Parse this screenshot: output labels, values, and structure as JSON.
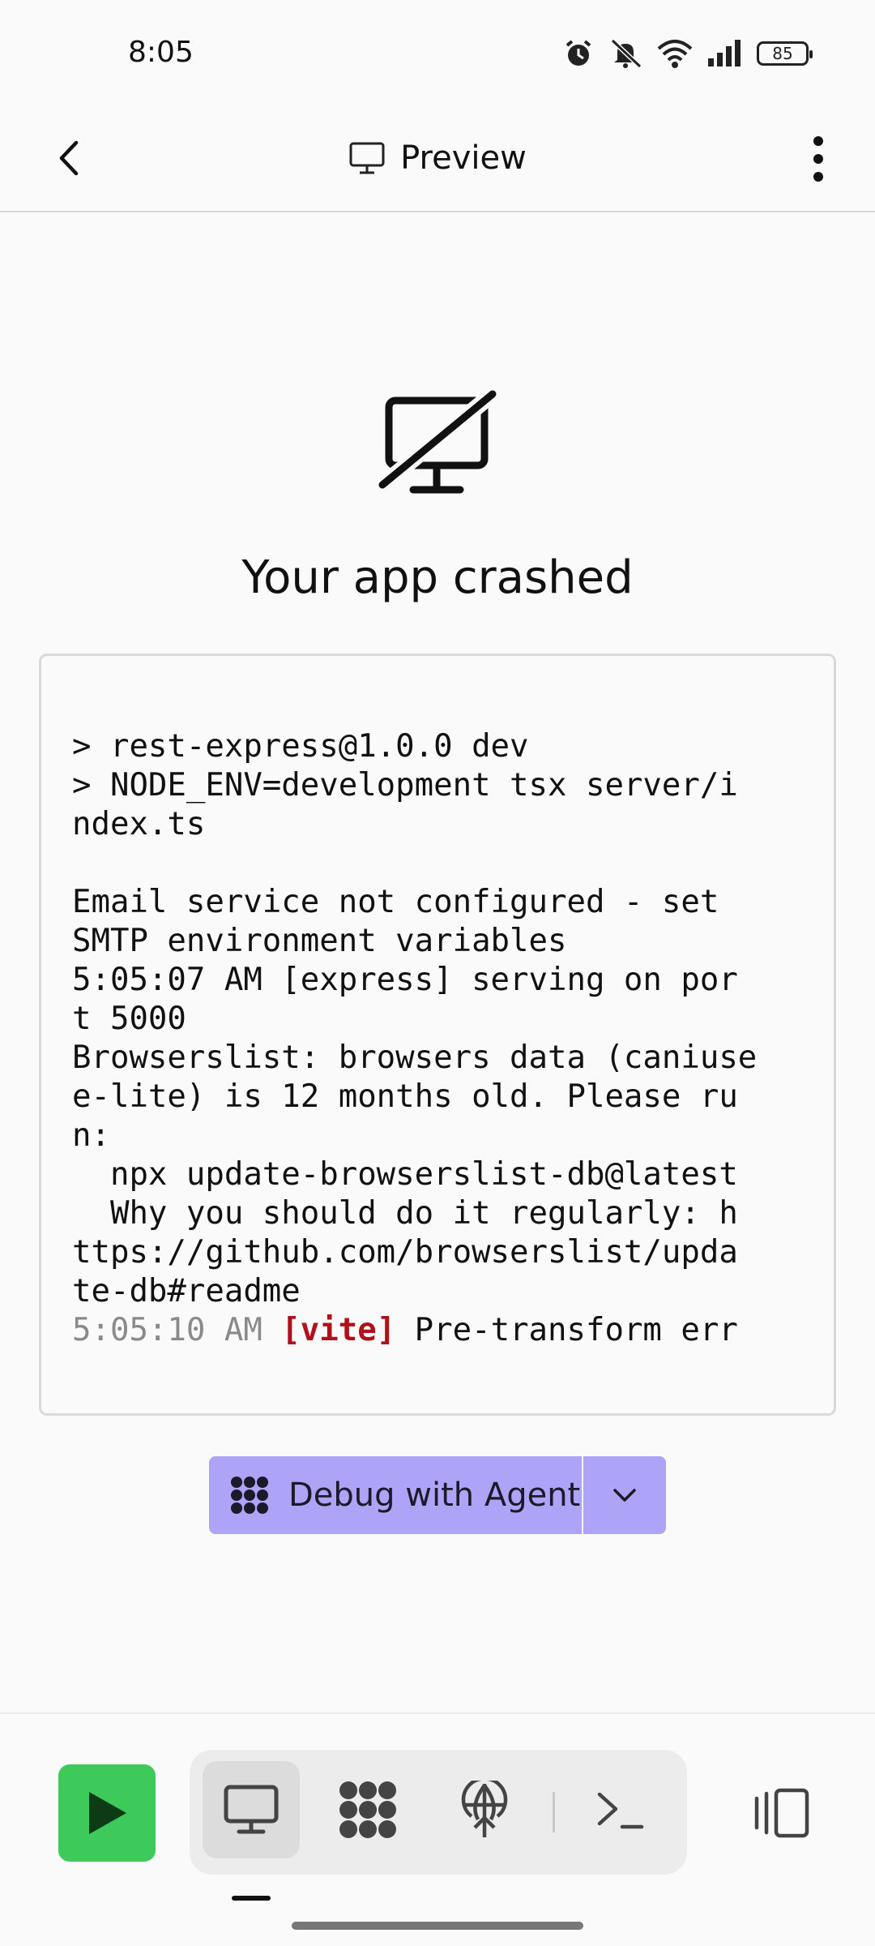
{
  "status_bar": {
    "time": "8:05",
    "battery": "85",
    "icons": [
      "alarm-icon",
      "mute-icon",
      "wifi-icon",
      "signal-icon",
      "battery-icon"
    ]
  },
  "header": {
    "title": "Preview",
    "icons": [
      "back-icon",
      "monitor-icon",
      "more-vertical-icon"
    ]
  },
  "crash": {
    "title": "Your app crashed",
    "icon": "monitor-off-icon"
  },
  "log": {
    "lines": [
      "> rest-express@1.0.0 dev",
      "> NODE_ENV=development tsx server/i",
      "ndex.ts",
      "",
      "Email service not configured - set",
      "SMTP environment variables",
      "5:05:07 AM [express] serving on por",
      "t 5000",
      "Browserslist: browsers data (caniuse",
      "e-lite) is 12 months old. Please ru",
      "n:",
      "  npx update-browserslist-db@latest",
      "  Why you should do it regularly: h",
      "ttps://github.com/browserslist/upda",
      "te-db#readme"
    ],
    "last_time": "5:05:10 AM",
    "last_tag": "[vite]",
    "last_rest": "Pre-transform err"
  },
  "debug": {
    "label": "Debug with Agent",
    "color": "#aea4f7"
  },
  "toolbar": {
    "run_color": "#3ec95b",
    "items": [
      "play-icon",
      "monitor-icon",
      "agent-icon",
      "deploy-icon",
      "terminal-icon",
      "panel-icon"
    ]
  }
}
